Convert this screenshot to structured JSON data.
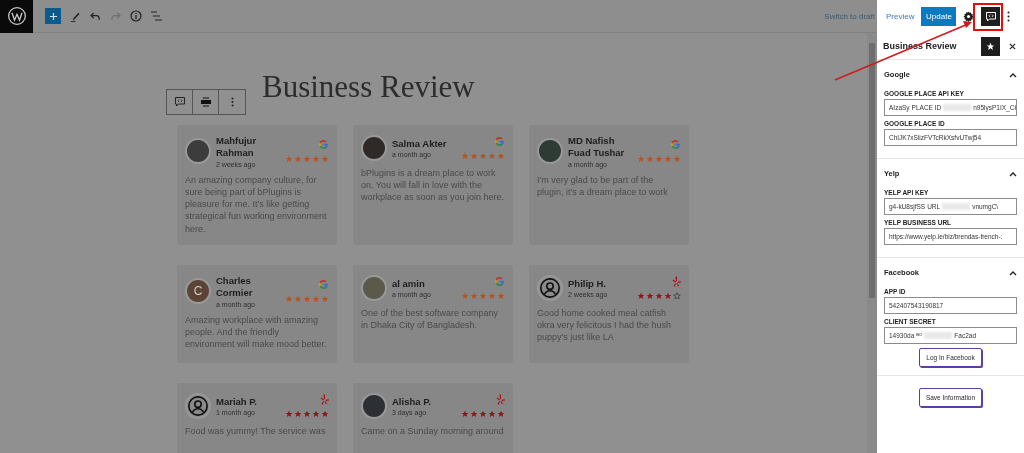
{
  "toolbar": {
    "switch_to_draft": "Switch to draft",
    "preview": "Preview",
    "update": "Update"
  },
  "page_title": "Business Review",
  "reviews": [
    {
      "name": "Mahfujur Rahman",
      "time": "2 weeks ago",
      "kind": "google",
      "avatar": {
        "kind": "photo"
      },
      "stars": 5,
      "text": "An amazing company culture, for sure being part of bPlugins is pleasure for me. It's like getting strategical fun working environment here."
    },
    {
      "name": "Salma Akter",
      "time": "a month ago",
      "kind": "google",
      "avatar": {
        "kind": "photo"
      },
      "stars": 5,
      "text": "bPlugins is a dream place to work on. You will fall in love with the workplace as soon as you join here."
    },
    {
      "name": "MD Nafish Fuad Tushar",
      "time": "a month ago",
      "kind": "google",
      "avatar": {
        "kind": "photo"
      },
      "stars": 5,
      "text": "I'm very glad to be part of the plugin, it's a dream place to work"
    },
    {
      "name": "Charles Cormier",
      "time": "a month ago",
      "kind": "google",
      "avatar": {
        "kind": "letter",
        "letter": "C"
      },
      "stars": 5,
      "text": "Amazing workplace with amazing people. And the friendly environment will make mood better."
    },
    {
      "name": "al amin",
      "time": "a month ago",
      "kind": "google",
      "avatar": {
        "kind": "photo"
      },
      "stars": 5,
      "text": "One of the best software company in Dhaka City of Bangladesh."
    },
    {
      "name": "Philip H.",
      "time": "2 weeks ago",
      "kind": "yelp",
      "avatar": {
        "kind": "silhouette"
      },
      "stars": 4,
      "text": "Good home cooked meal catfish okra very felicitous I had the hush puppy's just like LA"
    },
    {
      "name": "Mariah P.",
      "time": "1 month ago",
      "kind": "yelp",
      "avatar": {
        "kind": "silhouette"
      },
      "stars": 5,
      "text": "Food was yummy! The service was"
    },
    {
      "name": "Alisha P.",
      "time": "3 days ago",
      "kind": "yelp",
      "avatar": {
        "kind": "photo"
      },
      "stars": 5,
      "text": "Came on a Sunday morning around"
    }
  ],
  "sidebar": {
    "title": "Business Review",
    "panels": [
      {
        "title": "Google",
        "expanded": true,
        "fields": [
          {
            "label": "GOOGLE PLACE API KEY",
            "value_start": "AIzaSy",
            "overlay": "PLACE ID",
            "value_end": "n95lysP1IX_Cł"
          },
          {
            "label": "GOOGLE PLACE ID",
            "value_start": "ChIJK7xSiizFVTcRkXsfvUTwj54"
          }
        ]
      },
      {
        "title": "Yelp",
        "expanded": true,
        "fields": [
          {
            "label": "YELP API KEY",
            "value_start": "g4-kU8sjfSS",
            "overlay": "URL",
            "value_end": "vnumgC\\"
          },
          {
            "label": "YELP BUSINESS URL",
            "value_start": "https://www.yelp.ie/biz/brendas-french-:"
          }
        ]
      },
      {
        "title": "Facebook",
        "expanded": true,
        "fields": [
          {
            "label": "APP ID",
            "value_start": "542407543190817"
          },
          {
            "label": "CLIENT SECRET",
            "value_start": "14930da",
            "overlay": "ᴮᴼ",
            "value_end": "Fac2ad"
          }
        ],
        "button": "Log In Facebook"
      }
    ],
    "save_button": "Save Information"
  }
}
